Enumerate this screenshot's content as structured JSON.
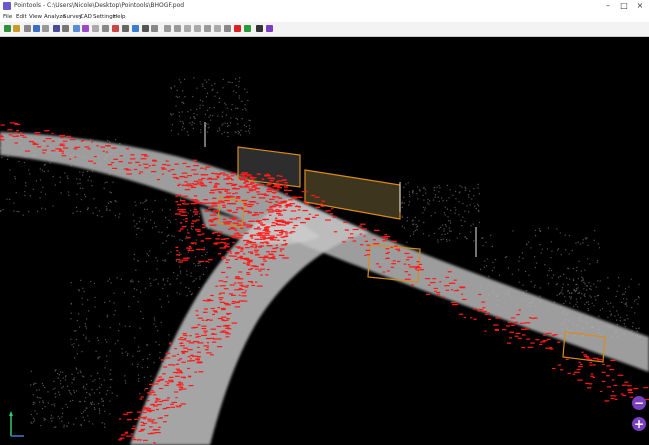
{
  "window": {
    "title": "Pointools - C:\\Users\\Nicole\\Desktop\\Pointools\\BHOGF.pod"
  },
  "menu": [
    "File",
    "Edit",
    "View",
    "Analyze",
    "Survey",
    "CAD",
    "Settings",
    "Help"
  ],
  "zoom": {
    "minus": "−",
    "plus": "+"
  },
  "colors": {
    "accent": "#7a3fbf",
    "points": "#ff1a1a",
    "highlight": "#ff9a00"
  }
}
